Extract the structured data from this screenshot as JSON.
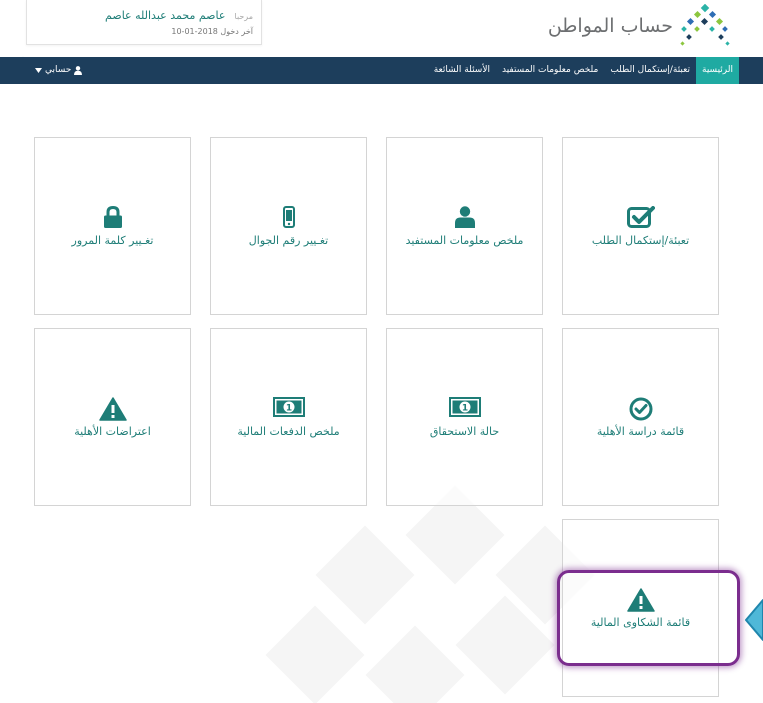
{
  "brand": {
    "name": "حساب المواطن",
    "logo_icon": "dots-logo-icon"
  },
  "user_card": {
    "welcome_label": "مرحبا",
    "user_name": "عاصم محمد عبدالله عاصم",
    "last_login": "آخر دخول 2018-01-10"
  },
  "nav": {
    "items": [
      {
        "label": "الرئيسية",
        "active": true
      },
      {
        "label": "تعبئة/إستكمال الطلب"
      },
      {
        "label": "ملخص معلومات المستفيد"
      },
      {
        "label": "الأسئلة الشائعة"
      }
    ],
    "account": {
      "label": "حسابي",
      "icon": "user-icon"
    }
  },
  "tiles": [
    {
      "label": "تعبئة/إستكمال الطلب",
      "icon": "check-square-icon"
    },
    {
      "label": "ملخص معلومات المستفيد",
      "icon": "user-icon"
    },
    {
      "label": "تغـيير رقم الجوال",
      "icon": "mobile-icon"
    },
    {
      "label": "تغـيير كلمة المرور",
      "icon": "lock-icon"
    },
    {
      "label": "قائمة دراسة الأهلية",
      "icon": "check-circle-icon"
    },
    {
      "label": "حالة الاستحقاق",
      "icon": "money-icon"
    },
    {
      "label": "ملخص الدفعات المالية",
      "icon": "money-icon"
    },
    {
      "label": "اعتراضات الأهلية",
      "icon": "warning-icon"
    },
    {
      "label": "قائمة الشكاوى المالية",
      "icon": "warning-icon"
    }
  ],
  "colors": {
    "navbar": "#1d3e5c",
    "active_tab": "#1faaa2",
    "accent": "#1e7d77",
    "highlight": "#7b2d8e",
    "pointer": "#2aa3c9"
  }
}
